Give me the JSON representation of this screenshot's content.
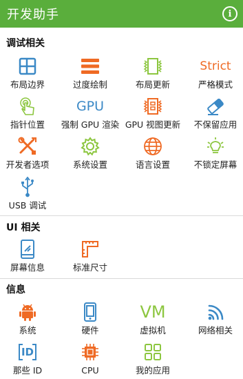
{
  "app": {
    "title": "开发助手"
  },
  "colors": {
    "appbar": "#5aae3c",
    "blue": "#3b89c6",
    "orange": "#ef6a24",
    "green": "#8cc63f"
  },
  "sections": {
    "debug": {
      "title": "调试相关",
      "items": [
        {
          "label": "布局边界",
          "icon": "layout-bounds-icon"
        },
        {
          "label": "过度绘制",
          "icon": "overdraw-icon"
        },
        {
          "label": "布局更新",
          "icon": "layout-update-icon"
        },
        {
          "label": "严格模式",
          "icon": "strict-mode-icon",
          "icon_text": "Strict"
        },
        {
          "label": "指针位置",
          "icon": "pointer-location-icon"
        },
        {
          "label": "强制 GPU 渲染",
          "icon": "gpu-render-icon",
          "icon_text": "GPU"
        },
        {
          "label": "GPU 视图更新",
          "icon": "gpu-view-update-icon"
        },
        {
          "label": "不保留应用",
          "icon": "eraser-icon"
        },
        {
          "label": "开发者选项",
          "icon": "developer-options-icon"
        },
        {
          "label": "系统设置",
          "icon": "gear-icon"
        },
        {
          "label": "语言设置",
          "icon": "globe-icon"
        },
        {
          "label": "不锁定屏幕",
          "icon": "lightbulb-icon"
        },
        {
          "label": "USB 调试",
          "icon": "usb-icon"
        }
      ]
    },
    "ui": {
      "title": "UI 相关",
      "items": [
        {
          "label": "屏幕信息",
          "icon": "phone-screen-icon"
        },
        {
          "label": "标准尺寸",
          "icon": "ruler-icon"
        }
      ]
    },
    "info": {
      "title": "信息",
      "items": [
        {
          "label": "系统",
          "icon": "android-icon"
        },
        {
          "label": "硬件",
          "icon": "hardware-phone-icon"
        },
        {
          "label": "虚拟机",
          "icon": "vm-icon",
          "icon_text": "VM"
        },
        {
          "label": "网络相关",
          "icon": "wifi-icon"
        },
        {
          "label": "那些 ID",
          "icon": "id-icon",
          "icon_text": "ID"
        },
        {
          "label": "CPU",
          "icon": "cpu-icon"
        },
        {
          "label": "我的应用",
          "icon": "apps-grid-icon"
        }
      ]
    }
  }
}
